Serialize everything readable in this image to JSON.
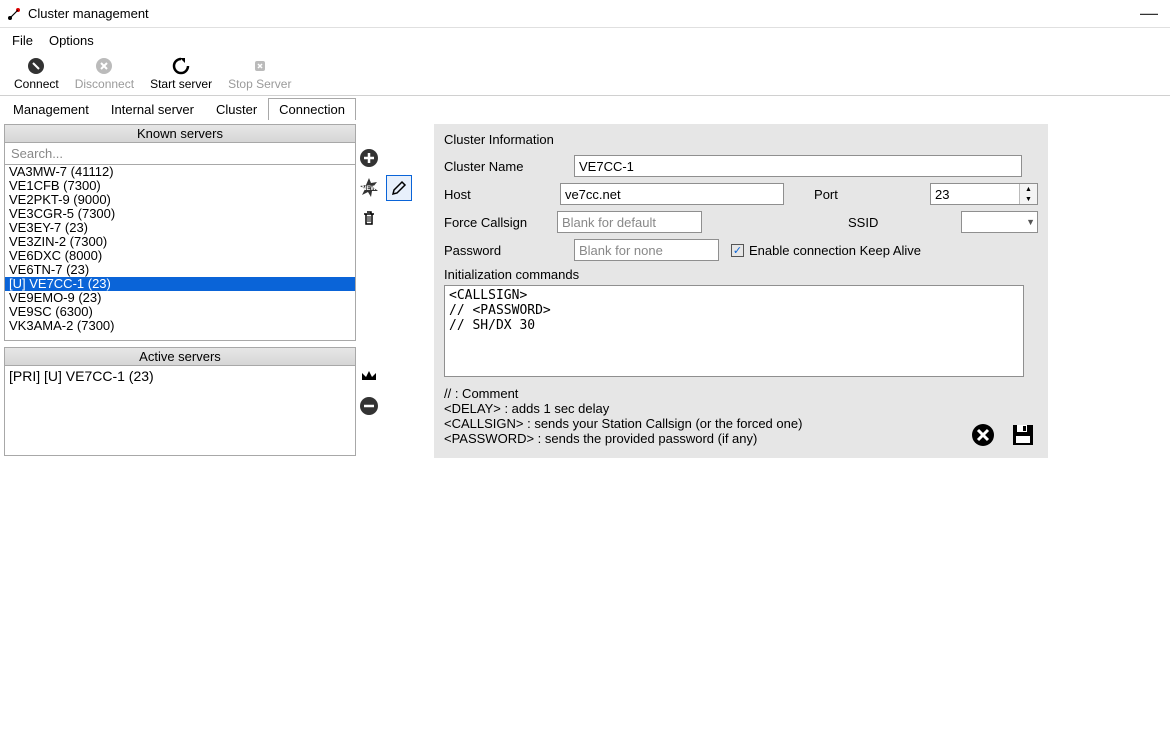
{
  "window": {
    "title": "Cluster management"
  },
  "menu": {
    "file": "File",
    "options": "Options"
  },
  "toolbar": {
    "connect": "Connect",
    "disconnect": "Disconnect",
    "start": "Start server",
    "stop": "Stop Server"
  },
  "tabs": {
    "management": "Management",
    "internal": "Internal server",
    "cluster": "Cluster",
    "connection": "Connection"
  },
  "known": {
    "header": "Known servers",
    "search_ph": "Search...",
    "items": [
      "VA3MW-7 (41112)",
      "VE1CFB (7300)",
      "VE2PKT-9 (9000)",
      "VE3CGR-5 (7300)",
      "VE3EY-7 (23)",
      "VE3ZIN-2 (7300)",
      "VE6DXC (8000)",
      "VE6TN-7 (23)",
      "[U] VE7CC-1 (23)",
      "VE9EMO-9 (23)",
      "VE9SC (6300)",
      "VK3AMA-2 (7300)"
    ],
    "selected_index": 8
  },
  "active": {
    "header": "Active servers",
    "item": "[PRI] [U] VE7CC-1 (23)"
  },
  "form": {
    "section": "Cluster Information",
    "cluster_name_lbl": "Cluster Name",
    "cluster_name_val": "VE7CC-1",
    "host_lbl": "Host",
    "host_val": "ve7cc.net",
    "port_lbl": "Port",
    "port_val": "23",
    "force_lbl": "Force Callsign",
    "force_ph": "Blank for default",
    "ssid_lbl": "SSID",
    "password_lbl": "Password",
    "password_ph": "Blank for none",
    "keepalive_lbl": "Enable connection Keep Alive",
    "init_lbl": "Initialization commands",
    "init_val": "<CALLSIGN>\n// <PASSWORD>\n// SH/DX 30",
    "help1": "// : Comment",
    "help2": "<DELAY> : adds 1 sec delay",
    "help3": "<CALLSIGN> : sends your Station Callsign (or the forced one)",
    "help4": "<PASSWORD> : sends the provided password (if any)"
  }
}
